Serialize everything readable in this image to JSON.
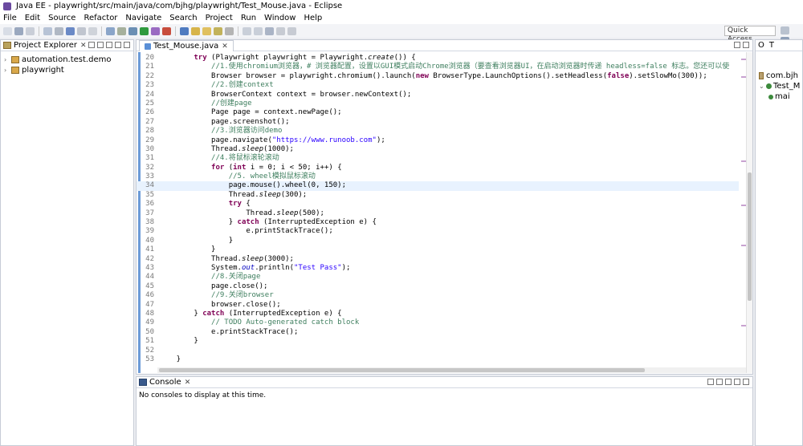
{
  "window": {
    "title": "Java EE - playwright/src/main/java/com/bjhg/playwright/Test_Mouse.java - Eclipse"
  },
  "menu": [
    "File",
    "Edit",
    "Source",
    "Refactor",
    "Navigate",
    "Search",
    "Project",
    "Run",
    "Window",
    "Help"
  ],
  "toolbar": {
    "quick_access": "Quick Access"
  },
  "explorer": {
    "tab": "Project Explorer",
    "items": [
      {
        "label": "automation.test.demo"
      },
      {
        "label": "playwright"
      }
    ]
  },
  "editor": {
    "tab": "Test_Mouse.java",
    "current_line": 34
  },
  "console": {
    "tab": "Console",
    "message": "No consoles to display at this time."
  },
  "outline": {
    "tab1": "O",
    "tab2": "T",
    "items": [
      "com.bjh",
      "Test_M",
      "mai"
    ]
  },
  "colors": {
    "keyword": "#7f0055",
    "comment": "#3f7f5f",
    "string": "#2a00ff",
    "current_line": "#e8f2fe",
    "gutter_strip": "#6c9bd8"
  }
}
